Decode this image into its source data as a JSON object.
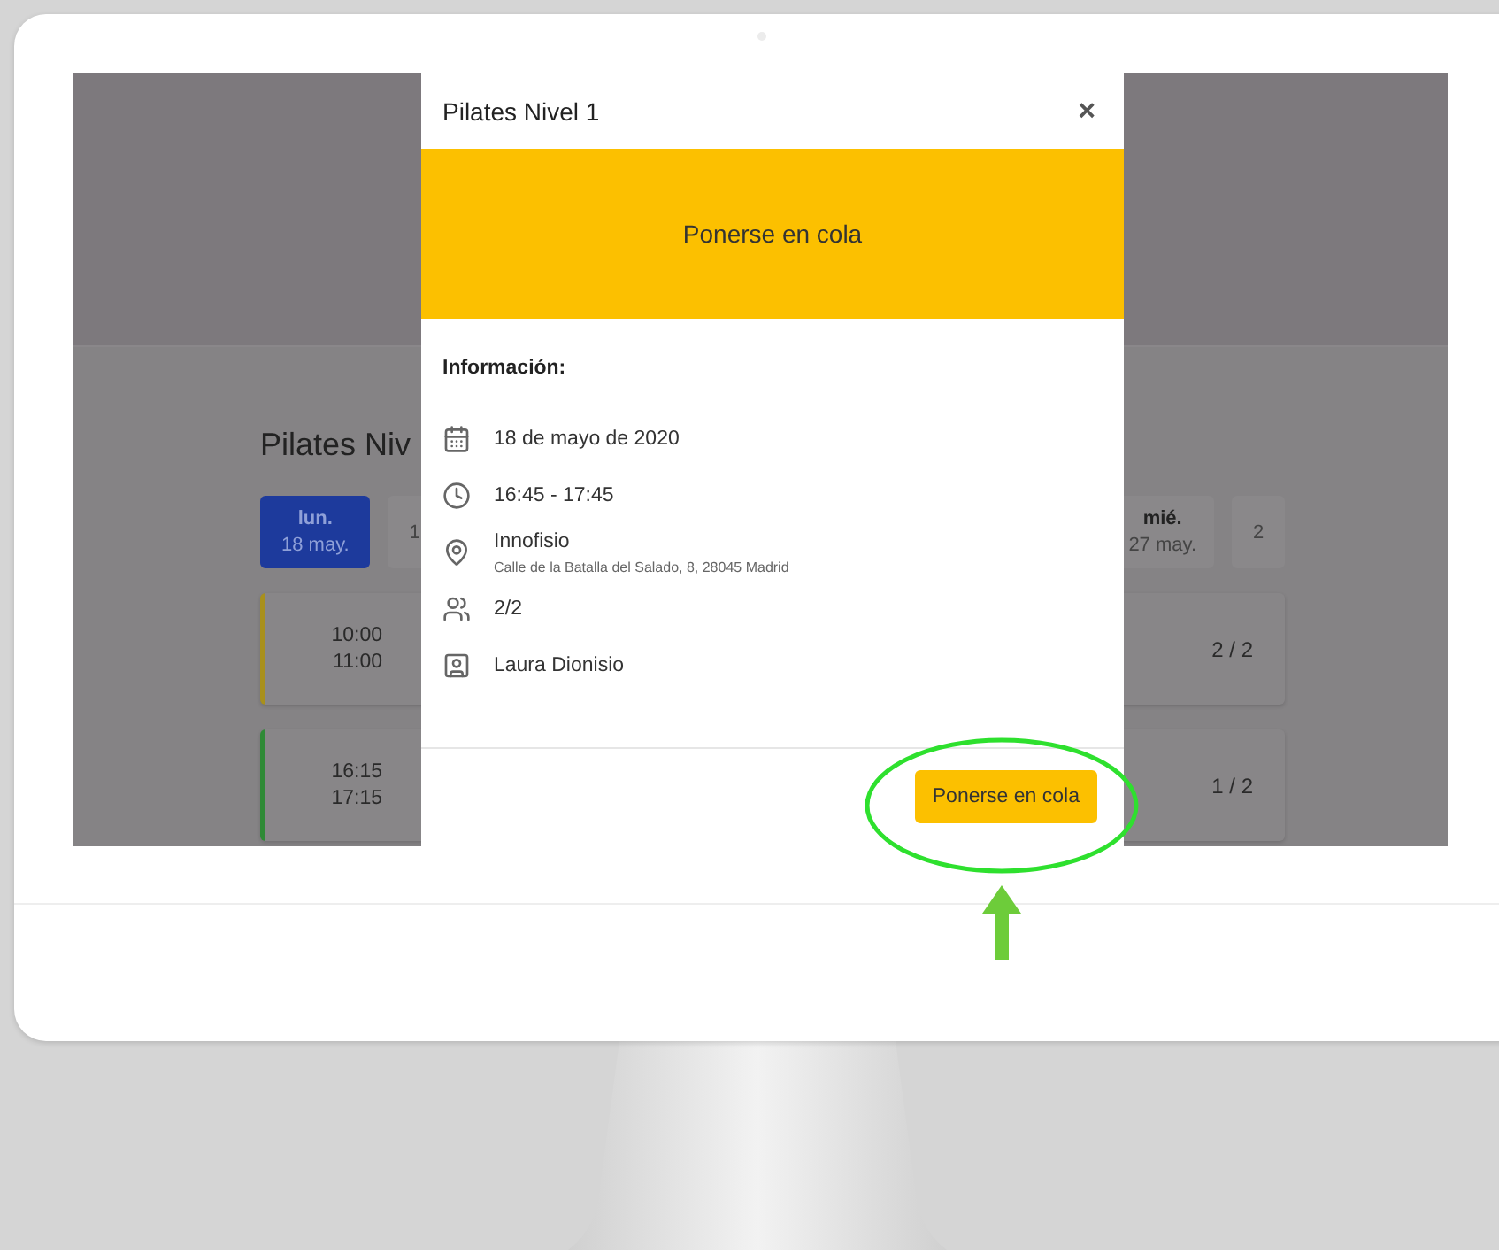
{
  "screen": {
    "page_title": "Pilates Niv",
    "days": [
      {
        "weekday": "lun.",
        "date": "18 may.",
        "selected": true
      },
      {
        "date": "1",
        "selected": false
      },
      {
        "weekday": "mié.",
        "date": "27 may.",
        "selected": false
      },
      {
        "date": "2",
        "selected": false
      }
    ],
    "sessions": [
      {
        "start": "10:00",
        "end": "11:00",
        "count": "2 / 2",
        "color": "#a8901c"
      },
      {
        "start": "16:15",
        "end": "17:15",
        "count": "1 / 2",
        "color": "#2f8a36"
      }
    ]
  },
  "modal": {
    "title": "Pilates Nivel 1",
    "close": "×",
    "banner": "Ponerse en cola",
    "info_heading": "Información:",
    "details": [
      {
        "kind": "date",
        "text": "18 de mayo de 2020"
      },
      {
        "kind": "time",
        "text": "16:45 - 17:45"
      },
      {
        "kind": "location",
        "text": "Innofisio",
        "subtext": "Calle de la Batalla del Salado, 8, 28045 Madrid"
      },
      {
        "kind": "capacity",
        "text": "2/2"
      },
      {
        "kind": "instructor",
        "text": "Laura Dionisio"
      }
    ],
    "button": "Ponerse en cola"
  }
}
